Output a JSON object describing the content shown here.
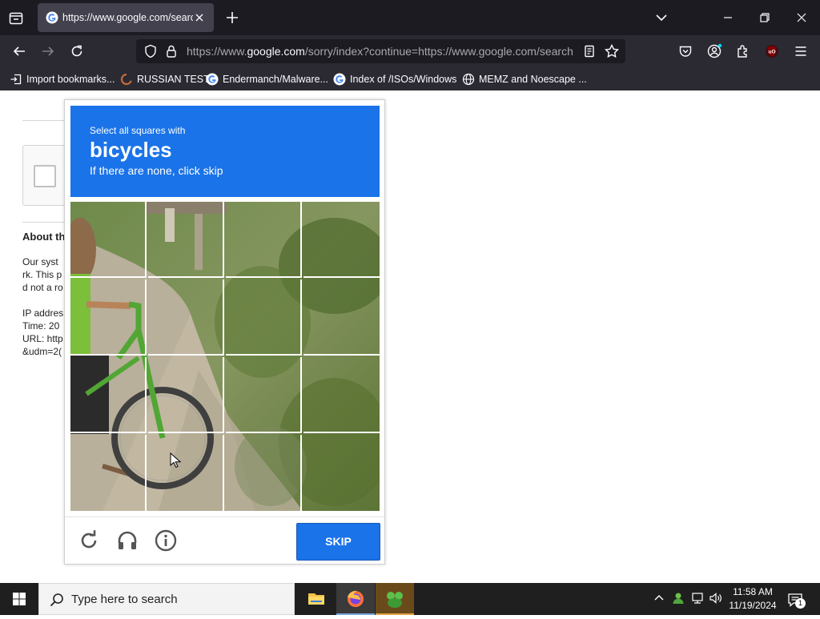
{
  "browser": {
    "tab": {
      "title": "https://www.google.com/search"
    },
    "url": {
      "prefix": "https://www.",
      "host": "google.com",
      "rest": "/sorry/index?continue=https://www.google.com/search"
    },
    "bookmarks": [
      {
        "label": "Import bookmarks...",
        "icon": "import-icon"
      },
      {
        "label": "RUSSIAN TEST",
        "icon": "site-icon"
      },
      {
        "label": "Endermanch/Malware...",
        "icon": "google-icon"
      },
      {
        "label": "Index of /ISOs/Windows",
        "icon": "google-icon"
      },
      {
        "label": "MEMZ and Noescape ...",
        "icon": "globe-icon"
      }
    ]
  },
  "page": {
    "about_heading": "About th",
    "text_lines": [
      "Our syst",
      "rk. This p",
      "d not a ro"
    ],
    "ip_lines": [
      "IP addres",
      "Time: 20",
      "URL: http",
      "&udm=2("
    ]
  },
  "captcha": {
    "instruction_line1": "Select all squares with",
    "target": "bicycles",
    "instruction_line3": "If there are none, click skip",
    "skip_label": "SKIP",
    "header_color": "#1a73e8"
  },
  "taskbar": {
    "search_placeholder": "Type here to search",
    "time": "11:58 AM",
    "date": "11/19/2024",
    "notification_count": "1"
  }
}
